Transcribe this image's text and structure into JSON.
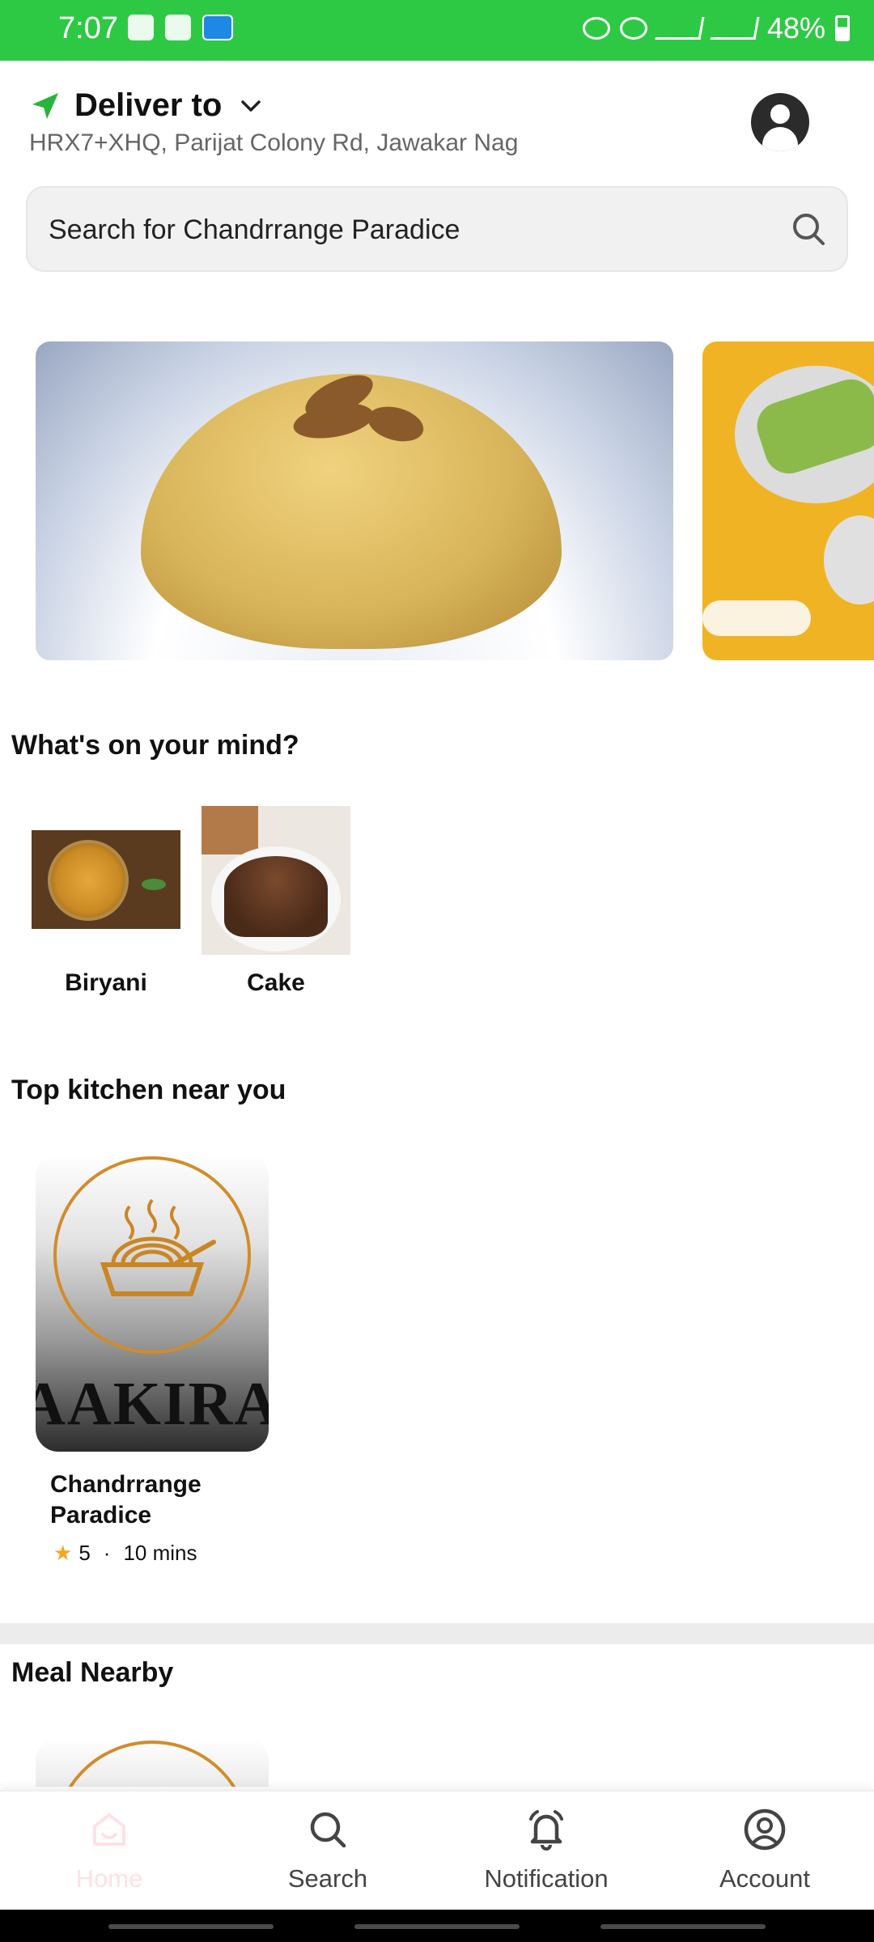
{
  "status_bar": {
    "time": "7:07",
    "battery": "48%"
  },
  "header": {
    "deliver_label": "Deliver to",
    "address": "HRX7+XHQ, Parijat Colony Rd, Jawakar Nag"
  },
  "search": {
    "placeholder": "Search for Chandrrange Paradice"
  },
  "categories": {
    "title": "What's on your mind?",
    "items": [
      {
        "label": "Biryani"
      },
      {
        "label": "Cake"
      }
    ]
  },
  "top_kitchen": {
    "title": "Top kitchen near you",
    "card": {
      "logo_text": "AAKIRAS",
      "name": "Chandrrange Paradice",
      "rating": "5",
      "time": "10 mins"
    }
  },
  "meal_nearby": {
    "title": "Meal Nearby"
  },
  "bottom_nav": {
    "items": [
      {
        "label": "Home",
        "icon": "home-icon",
        "active": true
      },
      {
        "label": "Search",
        "icon": "search-icon",
        "active": false
      },
      {
        "label": "Notification",
        "icon": "bell-icon",
        "active": false
      },
      {
        "label": "Account",
        "icon": "account-icon",
        "active": false
      }
    ]
  },
  "colors": {
    "status_bar": "#2ec944",
    "accent_orange": "#d18c2a",
    "star": "#f5a623",
    "home_active_tint": "#fde1e6"
  }
}
